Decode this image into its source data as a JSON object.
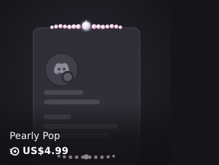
{
  "product": {
    "name": "Pearly Pop",
    "price": "US$4.99",
    "price_icon": "nitro-orb-icon"
  },
  "preview": {
    "avatar_icon": "discord-logo-icon",
    "decoration_icon": "pearl-necklace-icon"
  },
  "colors": {
    "pearl": "#f6dbe9",
    "pearl_glow": "#ffffff",
    "accent_pink": "#e8a6cf",
    "panel": "#302f37"
  }
}
